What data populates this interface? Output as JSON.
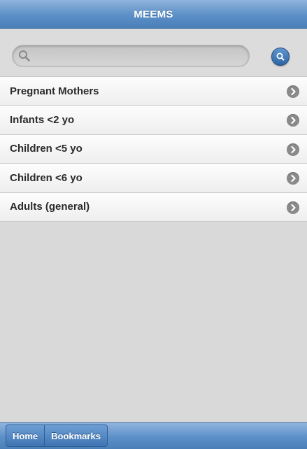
{
  "header": {
    "title": "MEEMS"
  },
  "search": {
    "value": "",
    "placeholder": ""
  },
  "list": {
    "items": [
      {
        "label": "Pregnant Mothers"
      },
      {
        "label": "Infants <2 yo"
      },
      {
        "label": "Children <5 yo"
      },
      {
        "label": "Children <6 yo"
      },
      {
        "label": "Adults (general)"
      }
    ]
  },
  "footer": {
    "tabs": [
      {
        "label": "Home"
      },
      {
        "label": "Bookmarks"
      }
    ]
  },
  "colors": {
    "header_blue": "#5b8fc7",
    "background": "#d9d9d9",
    "chevron": "#8a8a8a"
  },
  "icons": {
    "search": "search-icon",
    "search_button": "magnifier-button-icon",
    "chevron": "chevron-right-icon"
  }
}
